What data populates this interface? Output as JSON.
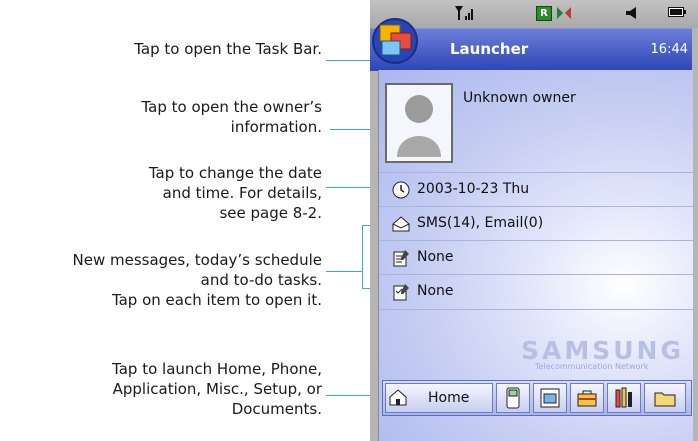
{
  "annotations": {
    "taskbar": "Tap to open the Task Bar.",
    "owner_1": "Tap to open the owner’s",
    "owner_2": "information.",
    "datetime_1": "Tap to change the date",
    "datetime_2": "and time. For details,",
    "datetime_3": "see page 8-2.",
    "messages_1": "New messages, today’s schedule",
    "messages_2": "and to-do tasks.",
    "messages_3": "Tap on each item to open it.",
    "launch_1": "Tap to launch Home, Phone,",
    "launch_2": "Application, Misc., Setup, or",
    "launch_3": "Documents."
  },
  "device": {
    "title": "Launcher",
    "time": "16:44",
    "owner": "Unknown owner",
    "date": "2003-10-23 Thu",
    "messages": "SMS(14),  Email(0)",
    "schedule": "None",
    "todo": "None",
    "brand": "SAMSUNG",
    "brand_sub": "Telecommunication Network",
    "home_label": "Home"
  },
  "icons": {
    "signal": "signal-icon",
    "network": "network-icon",
    "sync": "sync-icon",
    "speaker": "speaker-icon",
    "battery": "battery-icon",
    "taskbar": "taskbar-icon",
    "clock": "clock-icon",
    "message": "message-icon",
    "schedule": "schedule-icon",
    "todo": "todo-icon",
    "home": "home-icon",
    "phone": "phone-icon",
    "application": "application-icon",
    "misc": "misc-icon",
    "setup": "setup-icon",
    "documents": "folder-icon"
  },
  "colors": {
    "callout_line": "#3aa9d6",
    "titlebar": "#2d46b6",
    "screen_bg": "#c9d0f3"
  }
}
